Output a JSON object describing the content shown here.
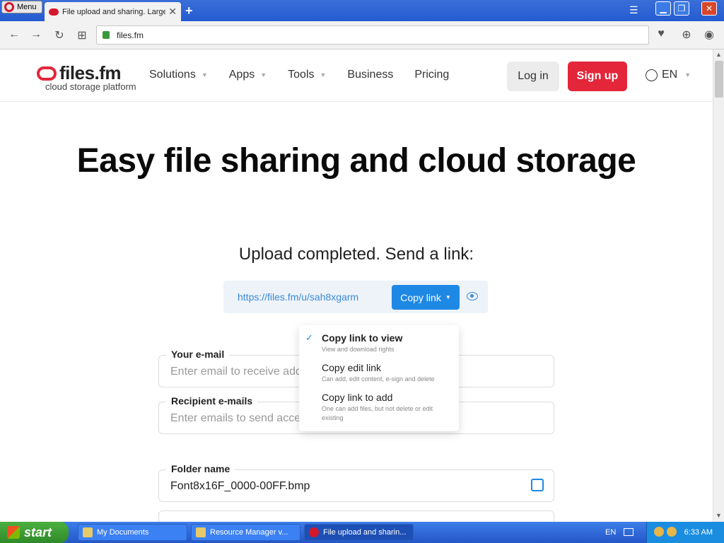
{
  "browser": {
    "menu_label": "Menu",
    "tab_title": "File upload and sharing. Large",
    "tab_close": "✕",
    "new_tab": "+",
    "url": "files.fm",
    "window_controls": [
      "▁",
      "❐",
      "✕"
    ]
  },
  "site": {
    "logo_text": "files.fm",
    "logo_tagline": "cloud storage platform",
    "nav": [
      {
        "label": "Solutions",
        "has_caret": true
      },
      {
        "label": "Apps",
        "has_caret": true
      },
      {
        "label": "Tools",
        "has_caret": true
      },
      {
        "label": "Business",
        "has_caret": false
      },
      {
        "label": "Pricing",
        "has_caret": false
      }
    ],
    "login_label": "Log in",
    "signup_label": "Sign up",
    "language": "EN",
    "colors": {
      "brand": "#e3263a",
      "accent": "#1e88e5"
    }
  },
  "main": {
    "hero_title": "Easy file sharing and cloud storage",
    "upload_status": "Upload completed. Send a link:",
    "share_link": "https://files.fm/u/sah8xgarm",
    "copy_button_label": "Copy link",
    "dropdown": [
      {
        "title": "Copy link to view",
        "desc": "View and download rights",
        "selected": true
      },
      {
        "title": "Copy edit link",
        "desc": "Can add, edit content, e-sign and delete",
        "selected": false
      },
      {
        "title": "Copy link to add",
        "desc": "One can add files, but not delete or edit existing",
        "selected": false
      }
    ],
    "your_email": {
      "label": "Your e-mail",
      "placeholder": "Enter email to receive add"
    },
    "recipient_emails": {
      "label": "Recipient e-mails",
      "placeholder": "Enter emails to send acce"
    },
    "folder_name": {
      "label": "Folder name",
      "value": "Font8x16F_0000-00FF.bmp"
    }
  },
  "taskbar": {
    "start_label": "start",
    "tasks": [
      {
        "label": "My Documents",
        "active": false
      },
      {
        "label": "Resource Manager v...",
        "active": false
      },
      {
        "label": "File upload and sharin...",
        "active": true
      }
    ],
    "language_indicator": "EN",
    "clock": "6:33 AM"
  }
}
